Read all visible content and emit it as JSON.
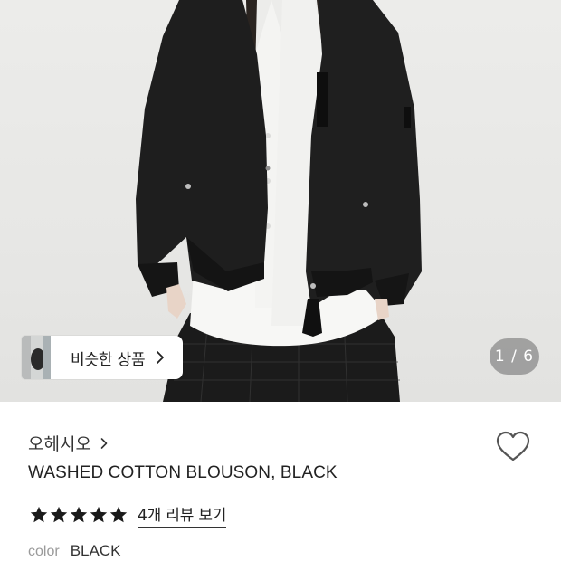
{
  "gallery": {
    "similar_label": "비슷한 상품",
    "counter": "1 / 6"
  },
  "product": {
    "brand": "오헤시오",
    "title": "WASHED COTTON BLOUSON, BLACK",
    "rating": 5,
    "review_link": "4개 리뷰 보기",
    "color_key": "color",
    "color_value": "BLACK"
  },
  "icons": {
    "chevron": "chevron-right-icon",
    "wish": "heart-icon",
    "star": "star-icon"
  },
  "colors": {
    "star": "#1a1a1a",
    "jacket": "#1f1f1f",
    "shirt": "#f7f7f5"
  }
}
